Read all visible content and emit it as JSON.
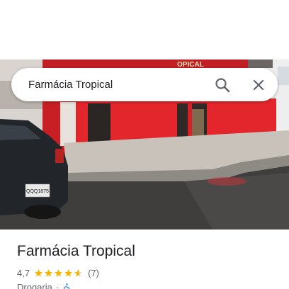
{
  "colors": {
    "accent_star": "#f4b400",
    "accessibility_blue": "#1a73e8",
    "storefront_red": "#e3262b",
    "text_primary": "#202124",
    "text_secondary": "#5f6368"
  },
  "search": {
    "query": "Farmácia Tropical",
    "search_icon": "search-icon",
    "close_icon": "close-icon"
  },
  "photo": {
    "sign_partial": "OPICAL",
    "car_plate": "QQQ1875"
  },
  "place": {
    "name": "Farmácia Tropical",
    "rating": "4,7",
    "rating_fraction": 0.94,
    "review_count": "(7)",
    "category": "Drogaria",
    "separator": "·",
    "accessibility_icon": "wheelchair-icon"
  }
}
